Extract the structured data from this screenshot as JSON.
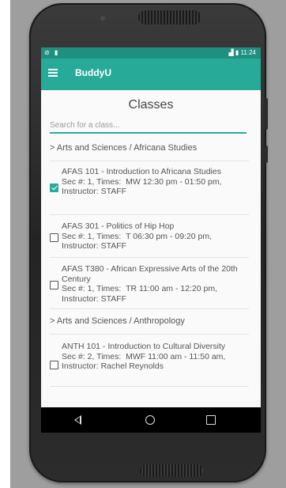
{
  "status_bar": {
    "left_icons": "⊘ ▮",
    "time": "11:24",
    "signal_battery": "▟ ▮"
  },
  "app_bar": {
    "title": "BuddyU"
  },
  "page": {
    "title": "Classes"
  },
  "search": {
    "placeholder": "Search for a class..."
  },
  "sections": [
    {
      "header": "> Arts and Sciences / Africana Studies",
      "items": [
        {
          "checked": true,
          "text": "AFAS 101 - Introduction to Africana Studies\n Sec #: 1, Times:  MW 12:30 pm - 01:50 pm, Instructor: STAFF"
        },
        {
          "checked": false,
          "text": "AFAS 301 - Politics of Hip Hop\n Sec #: 1, Times:  T 06:30 pm - 09:20 pm, Instructor: STAFF"
        },
        {
          "checked": false,
          "text": "AFAS T380 - African Expressive Arts of the 20th Century\n Sec #: 1, Times:  TR 11:00 am - 12:20 pm, Instructor: STAFF"
        }
      ]
    },
    {
      "header": "> Arts and Sciences / Anthropology",
      "items": [
        {
          "checked": false,
          "text": "ANTH 101 - Introduction to Cultural Diversity\n Sec #: 2, Times:  MWF 11:00 am - 11:50 am, Instructor: Rachel Reynolds"
        }
      ]
    }
  ],
  "nav": {
    "back_icon": "back-triangle-icon",
    "home_icon": "home-circle-icon",
    "recents_icon": "recents-square-icon"
  },
  "colors": {
    "accent": "#27ab98",
    "status_bar": "#1f8f80"
  }
}
